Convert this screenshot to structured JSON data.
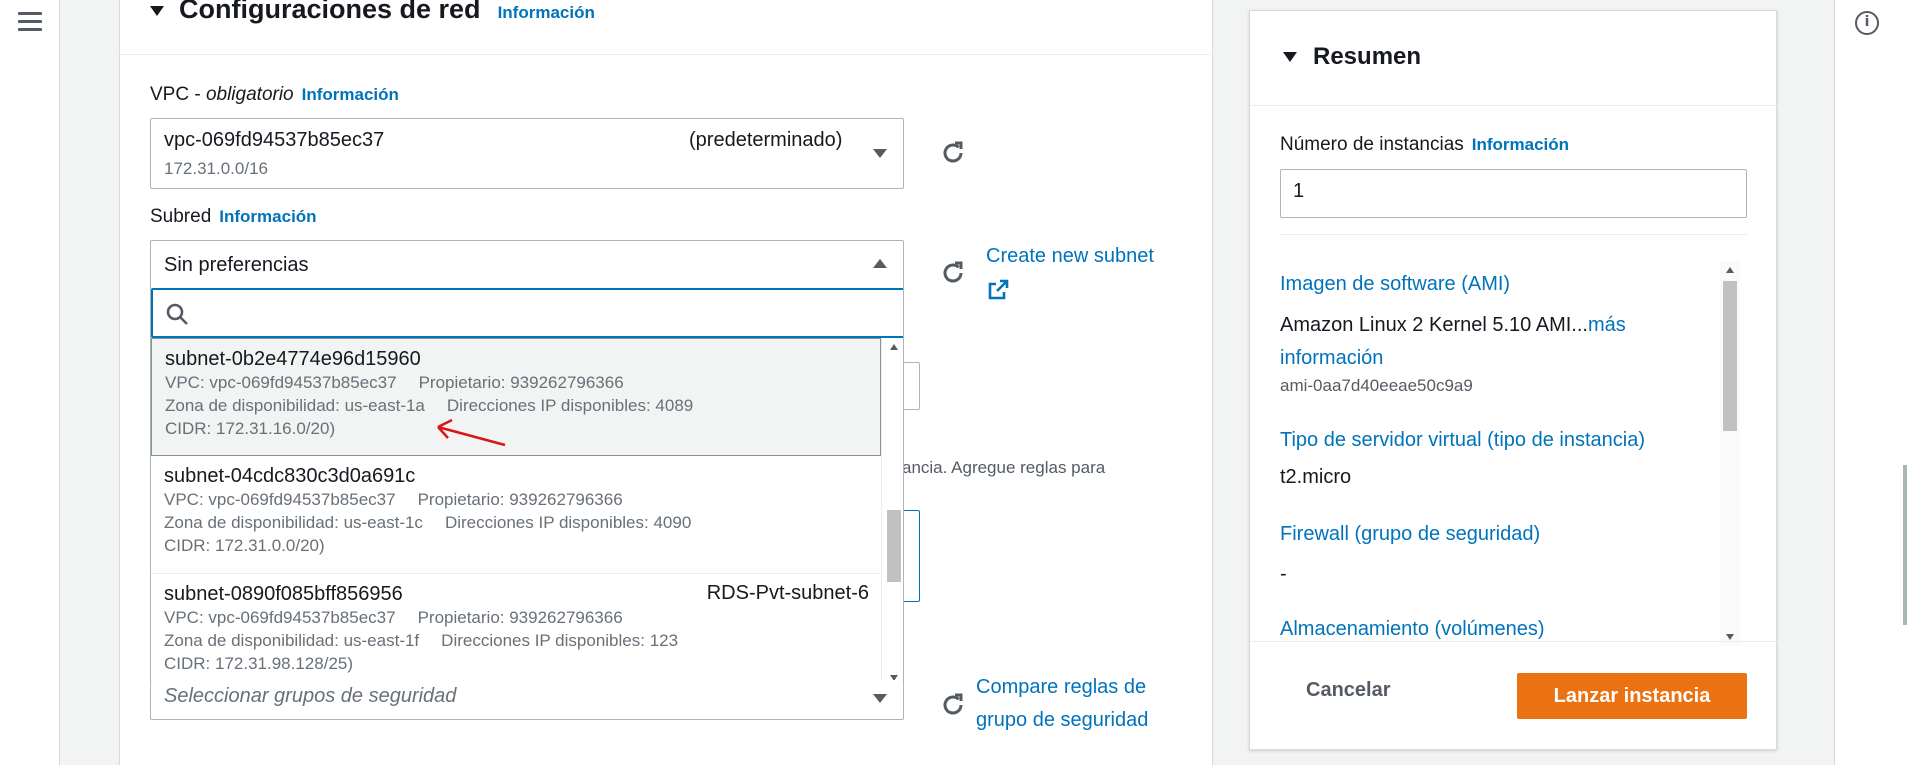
{
  "network": {
    "title": "Configuraciones de red",
    "info": "Información",
    "vpc_label": "VPC - ",
    "vpc_required": "obligatorio",
    "vpc_value": "vpc-069fd94537b85ec37",
    "vpc_tag": "(predeterminado)",
    "vpc_cidr": "172.31.0.0/16",
    "subnet_label": "Subred",
    "subnet_value": "Sin preferencias",
    "create_subnet": "Create new subnet",
    "search_value": "",
    "behind_text": "ancia. Agregue reglas para",
    "sg_placeholder": "Seleccionar grupos de seguridad",
    "compare_rules_1": "Compare reglas de",
    "compare_rules_2": "grupo de seguridad"
  },
  "subnets": [
    {
      "id": "subnet-0b2e4774e96d15960",
      "tag": "",
      "vpc": "VPC: vpc-069fd94537b85ec37",
      "owner": "Propietario: 939262796366",
      "az": "Zona de disponibilidad: us-east-1a",
      "ips": "Direcciones IP disponibles: 4089",
      "cidr": "CIDR: 172.31.16.0/20)"
    },
    {
      "id": "subnet-04cdc830c3d0a691c",
      "tag": "",
      "vpc": "VPC: vpc-069fd94537b85ec37",
      "owner": "Propietario: 939262796366",
      "az": "Zona de disponibilidad: us-east-1c",
      "ips": "Direcciones IP disponibles: 4090",
      "cidr": "CIDR: 172.31.0.0/20)"
    },
    {
      "id": "subnet-0890f085bff856956",
      "tag": "RDS-Pvt-subnet-6",
      "vpc": "VPC: vpc-069fd94537b85ec37",
      "owner": "Propietario: 939262796366",
      "az": "Zona de disponibilidad: us-east-1f",
      "ips": "Direcciones IP disponibles: 123",
      "cidr": "CIDR: 172.31.98.128/25)"
    }
  ],
  "summary": {
    "title": "Resumen",
    "instances_label": "Número de instancias",
    "info": "Información",
    "instances_value": "1",
    "ami_label": "Imagen de software (AMI)",
    "ami_value": "Amazon Linux 2 Kernel 5.10 AMI...",
    "ami_more_1": "más",
    "ami_more_2": "información",
    "ami_id": "ami-0aa7d40eeae50c9a9",
    "instance_type_label": "Tipo de servidor virtual (tipo de instancia)",
    "instance_type_value": "t2.micro",
    "firewall_label": "Firewall (grupo de seguridad)",
    "firewall_value": "-",
    "storage_label": "Almacenamiento (volúmenes)",
    "cancel": "Cancelar",
    "launch": "Lanzar instancia"
  },
  "colors": {
    "link": "#0073bb",
    "primary_button": "#ec7211",
    "annotation_arrow": "#d91515"
  }
}
